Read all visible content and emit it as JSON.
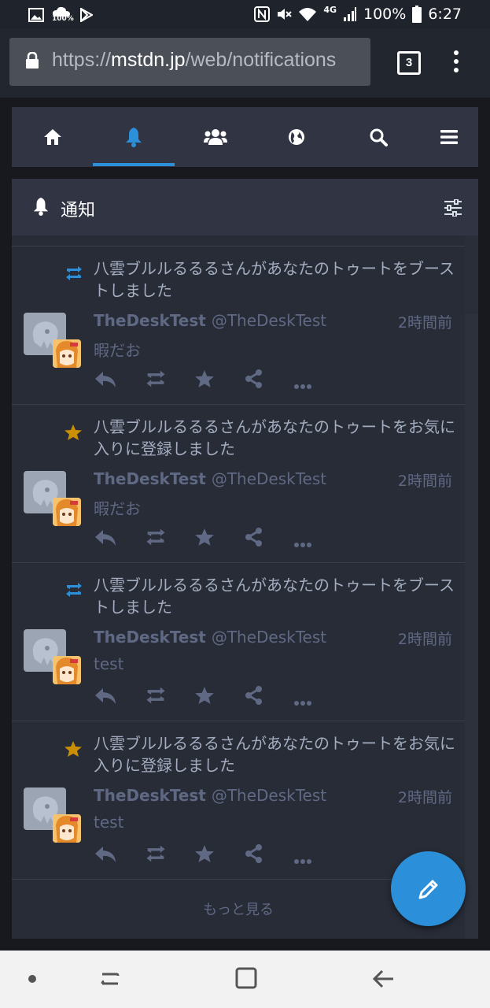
{
  "status_bar": {
    "battery": "100%",
    "time": "6:27",
    "network": "4G",
    "weather_badge": "100%",
    "icons": [
      "image-icon",
      "weather-icon",
      "play-store-icon",
      "nfc-icon",
      "mute-icon",
      "wifi-icon",
      "signal-icon",
      "battery-icon"
    ]
  },
  "browser": {
    "url_scheme": "https://",
    "url_host": "mstdn.jp",
    "url_path": "/web/notifications",
    "tab_count": "3"
  },
  "nav_tabs": [
    {
      "name": "home",
      "icon": "home-icon"
    },
    {
      "name": "notifications",
      "icon": "bell-icon",
      "active": true
    },
    {
      "name": "local",
      "icon": "users-icon"
    },
    {
      "name": "federated",
      "icon": "globe-icon"
    },
    {
      "name": "search",
      "icon": "search-icon"
    },
    {
      "name": "menu",
      "icon": "menu-icon"
    }
  ],
  "column": {
    "title": "通知",
    "accent_color": "#2b90d9"
  },
  "notifications": [
    {
      "type": "reblog",
      "icon": "retweet-icon",
      "message": "八雲ブルルるるるさんがあなたのトゥートをブーストしました",
      "display_name": "TheDeskTest",
      "acct": "@TheDeskTest",
      "time": "2時間前",
      "content": "暇だお"
    },
    {
      "type": "favourite",
      "icon": "star-icon",
      "message": "八雲ブルルるるるさんがあなたのトゥートをお気に入りに登録しました",
      "display_name": "TheDeskTest",
      "acct": "@TheDeskTest",
      "time": "2時間前",
      "content": "暇だお"
    },
    {
      "type": "reblog",
      "icon": "retweet-icon",
      "message": "八雲ブルルるるるさんがあなたのトゥートをブーストしました",
      "display_name": "TheDeskTest",
      "acct": "@TheDeskTest",
      "time": "2時間前",
      "content": "test"
    },
    {
      "type": "favourite",
      "icon": "star-icon",
      "message": "八雲ブルルるるるさんがあなたのトゥートをお気に入りに登録しました",
      "display_name": "TheDeskTest",
      "acct": "@TheDeskTest",
      "time": "2時間前",
      "content": "test"
    }
  ],
  "load_more": "もっと見る",
  "colors": {
    "boost": "#2b90d9",
    "favourite": "#ca8f04",
    "muted_text": "#606984"
  }
}
